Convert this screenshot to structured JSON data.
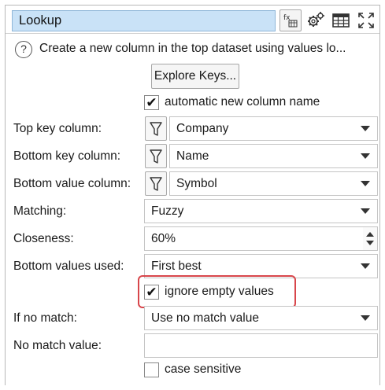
{
  "title": "Lookup",
  "toolbar": {
    "icons": [
      "calculator-icon",
      "gears-icon",
      "table-icon",
      "expand-icon"
    ]
  },
  "description": "Create a new column in the top dataset using values lo...",
  "explore_button": "Explore Keys...",
  "auto_name": {
    "checked": true,
    "label": "automatic new column name"
  },
  "fields": {
    "top_key": {
      "label": "Top key column:",
      "value": "Company"
    },
    "bottom_key": {
      "label": "Bottom key column:",
      "value": "Name"
    },
    "bottom_value": {
      "label": "Bottom value column:",
      "value": "Symbol"
    },
    "matching": {
      "label": "Matching:",
      "value": "Fuzzy"
    },
    "closeness": {
      "label": "Closeness:",
      "value": "60%"
    },
    "bottom_values_used": {
      "label": "Bottom values used:",
      "value": "First best"
    },
    "if_no_match": {
      "label": "If no match:",
      "value": "Use no match value"
    },
    "no_match_value": {
      "label": "No match value:",
      "value": ""
    }
  },
  "ignore_empty": {
    "checked": true,
    "label": "ignore empty values"
  },
  "case_sensitive": {
    "checked": false,
    "label": "case sensitive"
  },
  "colors": {
    "title_bg": "#c9e2f7",
    "highlight": "#d8464b"
  }
}
